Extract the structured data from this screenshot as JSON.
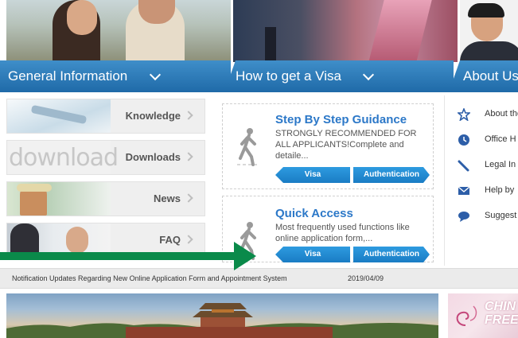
{
  "header": {
    "tabs": [
      {
        "label": "General Information"
      },
      {
        "label": "How to get a Visa"
      },
      {
        "label": "About Us"
      }
    ]
  },
  "left_menu": [
    {
      "label": "Knowledge",
      "thumb_text": ""
    },
    {
      "label": "Downloads",
      "thumb_text": "download"
    },
    {
      "label": "News",
      "thumb_text": ""
    },
    {
      "label": "FAQ",
      "thumb_text": ""
    }
  ],
  "cards": [
    {
      "title": "Step By Step Guidance",
      "description": "STRONGLY RECOMMENDED FOR ALL APPLICANTS!Complete and detaile...",
      "buttons": {
        "visa": "Visa",
        "auth": "Authentication"
      }
    },
    {
      "title": "Quick Access",
      "description": "Most frequently used functions like online application form,...",
      "buttons": {
        "visa": "Visa",
        "auth": "Authentication"
      }
    }
  ],
  "about_list": [
    {
      "label": "About the",
      "icon": "star-icon"
    },
    {
      "label": "Office H",
      "icon": "clock-icon"
    },
    {
      "label": "Legal In",
      "icon": "pen-icon"
    },
    {
      "label": "Help by",
      "icon": "mail-icon"
    },
    {
      "label": "Suggest",
      "icon": "chat-icon"
    }
  ],
  "notification": {
    "text": "Notification Updates Regarding New Online Application Form and Appointment System",
    "date": "2019/04/09"
  },
  "promo": {
    "line1": "CHIN",
    "line2": "FREE"
  },
  "colors": {
    "banner_blue": "#1f6aa8",
    "title_blue": "#2c78c8",
    "button_blue": "#1a7cc4",
    "arrow_green": "#0a8a4a"
  }
}
